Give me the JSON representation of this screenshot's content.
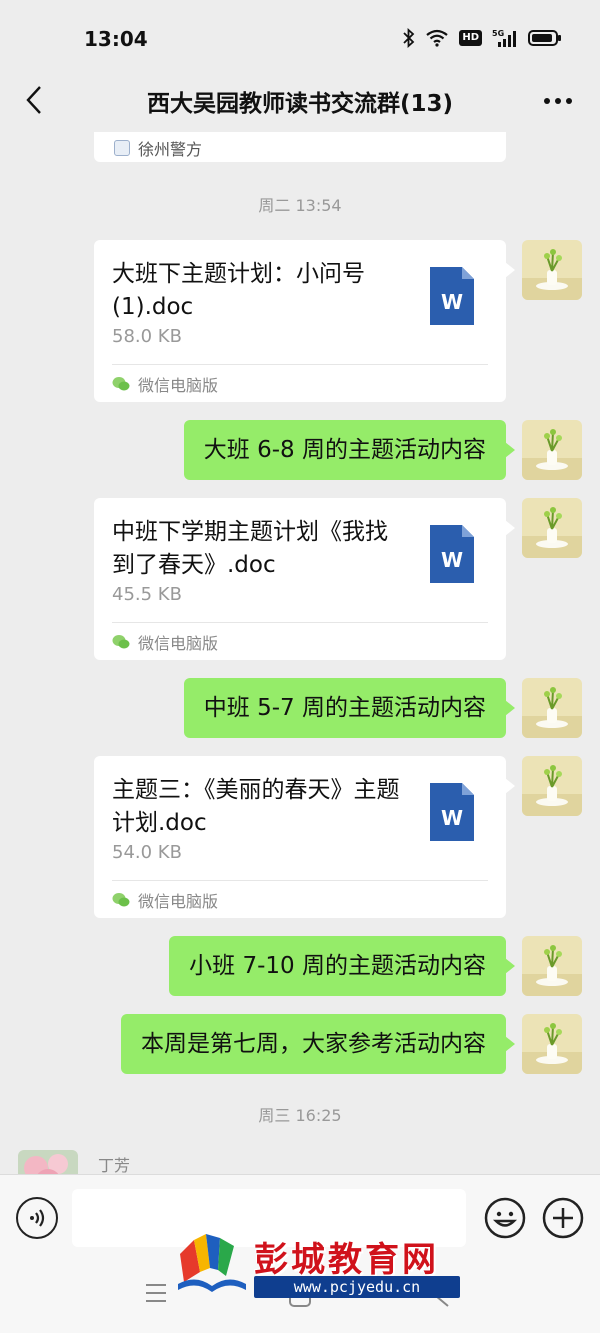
{
  "status_bar": {
    "time": "13:04",
    "network_badge": "HD",
    "cell_label": "5G"
  },
  "header": {
    "title": "西大吴园教师读书交流群(13)"
  },
  "top_card": {
    "source": "徐州警方"
  },
  "timestamps": [
    "周二 13:54",
    "周三 16:25"
  ],
  "files": [
    {
      "name": "大班下主题计划：小问号(1).doc",
      "size": "58.0 KB",
      "source": "微信电脑版",
      "icon": "word-doc-icon"
    },
    {
      "name": "中班下学期主题计划《我找到了春天》.doc",
      "size": "45.5 KB",
      "source": "微信电脑版",
      "icon": "word-doc-icon"
    },
    {
      "name": "主题三：《美丽的春天》主题计划.doc",
      "size": "54.0 KB",
      "source": "微信电脑版",
      "icon": "word-doc-icon"
    }
  ],
  "messages": [
    "大班 6-8 周的主题活动内容",
    "中班 5-7 周的主题活动内容",
    "小班 7-10 周的主题活动内容",
    "本周是第七周，大家参考活动内容"
  ],
  "incoming": {
    "sender": "丁芳"
  },
  "input": {
    "value": "",
    "placeholder": ""
  },
  "watermark": {
    "title": "彭城教育网",
    "url": "www.pcjyedu.cn"
  },
  "colors": {
    "sent_bubble": "#95ec69",
    "chat_bg": "#ededed",
    "watermark_red": "#d0121b",
    "watermark_blue": "#0f3e8f"
  }
}
